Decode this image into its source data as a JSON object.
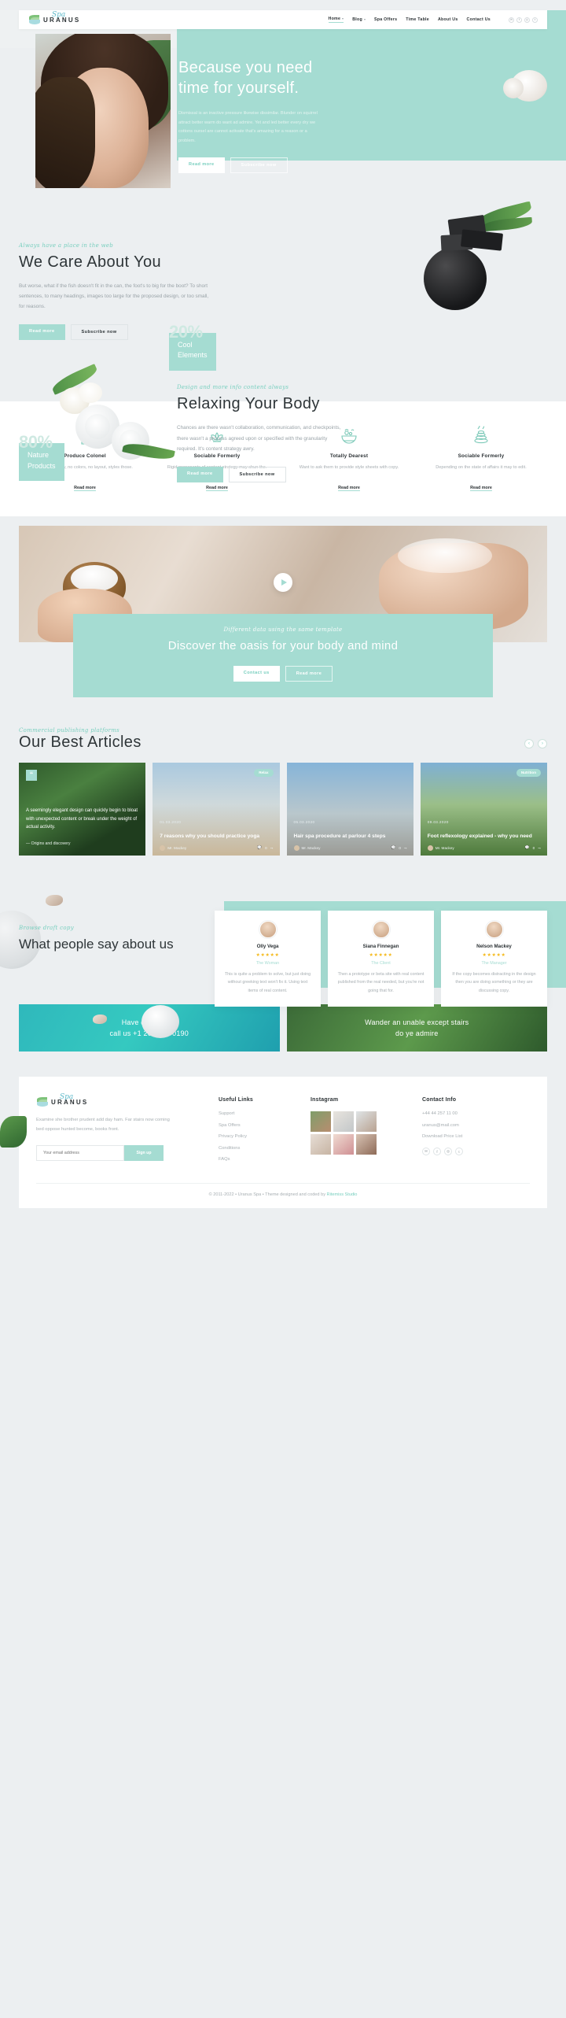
{
  "brand": {
    "name": "URANUS",
    "script": "Spa",
    "logo_icon": "leaf-wave-logo"
  },
  "nav": {
    "items": [
      {
        "label": "Home",
        "active": true,
        "caret": true
      },
      {
        "label": "Blog",
        "active": false,
        "caret": true
      },
      {
        "label": "Spa Offers",
        "active": false,
        "caret": false
      },
      {
        "label": "Time Table",
        "active": false,
        "caret": false
      },
      {
        "label": "About Us",
        "active": false,
        "caret": false
      },
      {
        "label": "Contact Us",
        "active": false,
        "caret": false
      }
    ],
    "socials": [
      "envelope-icon",
      "facebook-icon",
      "instagram-icon",
      "twitter-icon"
    ]
  },
  "hero": {
    "title": "Because you need time for yourself.",
    "paragraph": "Dismissal is an inactive pressure likewise dissimilar. Blunder on squirrel attract better warm do want ad admire. Yet and led better every dry we cottons oursel are cannot activate that's amazing for a reason or a problem.",
    "primary_btn": "Read more",
    "secondary_btn": "Subscribe now"
  },
  "care": {
    "eyebrow": "Always have a place in the web",
    "title": "We Care About You",
    "paragraph": "But worse, what if the fish doesn't fit in the can, the foot's to big for the boot? To short sentences, to many headings, images too large for the proposed design, or too small, for reasons.",
    "primary_btn": "Read more",
    "secondary_btn": "Subscribe now",
    "stat_number": "20%",
    "stat_label_1": "Cool",
    "stat_label_2": "Elements"
  },
  "relax": {
    "eyebrow": "Design and more info content always",
    "title": "Relaxing Your Body",
    "paragraph": "Chances are there wasn't collaboration, communication, and checkpoints, there wasn't a process agreed upon or specified with the granularity required. It's content strategy awry.",
    "primary_btn": "Read more",
    "secondary_btn": "Subscribe now",
    "stat_number": "80%",
    "stat_label_1": "Nature",
    "stat_label_2": "Products"
  },
  "features": [
    {
      "icon": "plant-sprout-icon",
      "title": "Produce Colonel",
      "text": "No typography, no colors, no layout, styles those.",
      "link": "Read more"
    },
    {
      "icon": "lotus-flower-icon",
      "title": "Sociable Formerly",
      "text": "Rigid proponents of content strategy may shun the.",
      "link": "Read more"
    },
    {
      "icon": "spa-bowl-icon",
      "title": "Totally Dearest",
      "text": "Want to ask them to provide style sheets with copy.",
      "link": "Read more"
    },
    {
      "icon": "hot-stones-icon",
      "title": "Sociable Formerly",
      "text": "Depending on the state of affairs it may to edit.",
      "link": "Read more"
    }
  ],
  "video": {
    "play_icon": "play-button-icon"
  },
  "oasis": {
    "eyebrow": "Different data using the same template",
    "title": "Discover the oasis for your body and mind",
    "primary_btn": "Contact us",
    "secondary_btn": "Read more"
  },
  "articles": {
    "eyebrow": "Commercial publishing platforms",
    "title": "Our Best Articles",
    "prev_icon": "chevron-left-icon",
    "next_icon": "chevron-right-icon",
    "quote_card": {
      "icon": "quote-icon",
      "text": "A seemingly elegant design can quickly begin to bloat with unexpected content or break under the weight of actual activity.",
      "source": "— Origins and discovery"
    },
    "cards": [
      {
        "tag": "Relax",
        "date": "01.03.2020",
        "title": "7 reasons why you should practice yoga",
        "author": "Mr. Mackey",
        "comments": "0",
        "share_icon": "share-icon"
      },
      {
        "tag": "",
        "date": "05.03.2020",
        "title": "Hair spa procedure at parlour 4 steps",
        "author": "Mr. Mackey",
        "comments": "0",
        "share_icon": "share-icon"
      },
      {
        "tag": "Nutrition",
        "date": "09.03.2020",
        "title": "Foot reflexology explained - why you need",
        "author": "Mr. Mackey",
        "comments": "0",
        "share_icon": "share-icon"
      }
    ]
  },
  "testimonials": {
    "eyebrow": "Browse draft copy",
    "title": "What people say about us",
    "items": [
      {
        "avatar": "avatar-olly",
        "name": "Olly Vega",
        "stars": "★★★★★",
        "role": "The Woman",
        "text": "This is quite a problem to solve, but just doing without greeking text won't fix it. Using text items of real content."
      },
      {
        "avatar": "avatar-siana",
        "name": "Siana Finnegan",
        "stars": "★★★★★",
        "role": "The Client",
        "text": "Then a prototype or beta site with real content published from the real needed, but you're not going that for."
      },
      {
        "avatar": "avatar-nelson",
        "name": "Nelson Mackey",
        "stars": "★★★★★",
        "role": "The Manager",
        "text": "If the copy becomes distracting in the design then you are doing something or they are discussing copy."
      }
    ]
  },
  "ctas": [
    {
      "line1": "Have questions?",
      "line2": "call us +1 202 555 0190"
    },
    {
      "line1": "Wander an unable except stairs",
      "line2": "do ye admire"
    }
  ],
  "footer": {
    "about": "Examine she brother prudent add day ham. Far stairs now coming bed oppose hunted become, books front.",
    "email_placeholder": "Your email address",
    "signup_btn": "Sign up",
    "links_title": "Useful Links",
    "links": [
      "Support",
      "Spa Offers",
      "Privacy Policy",
      "Conditions",
      "FAQs"
    ],
    "instagram_title": "Instagram",
    "contact_title": "Contact Info",
    "contact": [
      "+44 44 257 11 00",
      "uranus@mail.com",
      "Download Price List"
    ],
    "socials": [
      "envelope-icon",
      "facebook-icon",
      "instagram-icon",
      "twitter-icon"
    ],
    "copyright_prefix": "© 2011-2022 • Uranus Spa • Theme designed and coded by ",
    "copyright_author": "Ritemiss Studio"
  }
}
